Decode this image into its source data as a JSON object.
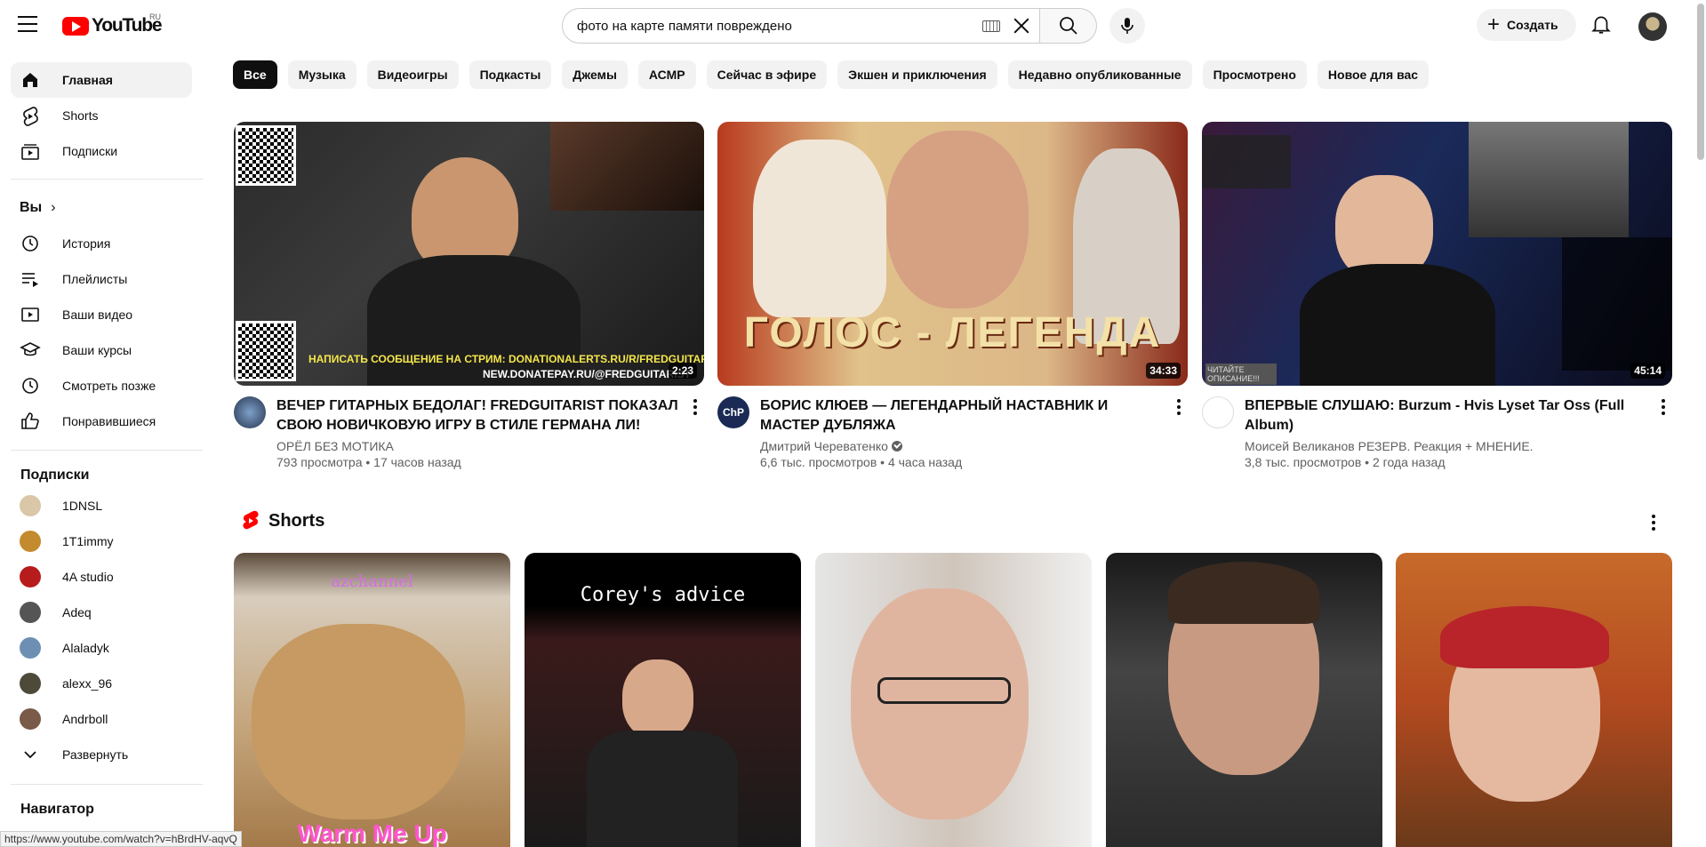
{
  "header": {
    "logo_text": "YouTube",
    "logo_region": "RU",
    "search_value": "фото на карте памяти повреждено",
    "create_label": "Создать"
  },
  "sidebar": {
    "main": [
      {
        "label": "Главная",
        "icon": "home-icon"
      },
      {
        "label": "Shorts",
        "icon": "shorts-icon"
      },
      {
        "label": "Подписки",
        "icon": "subscriptions-icon"
      }
    ],
    "you_heading": "Вы",
    "you": [
      {
        "label": "История",
        "icon": "history-icon"
      },
      {
        "label": "Плейлисты",
        "icon": "playlists-icon"
      },
      {
        "label": "Ваши видео",
        "icon": "your-videos-icon"
      },
      {
        "label": "Ваши курсы",
        "icon": "courses-icon"
      },
      {
        "label": "Смотреть позже",
        "icon": "watch-later-icon"
      },
      {
        "label": "Понравившиеся",
        "icon": "like-icon"
      }
    ],
    "subs_heading": "Подписки",
    "subs": [
      {
        "label": "1DNSL",
        "color": "#d9c7a8"
      },
      {
        "label": "1T1immy",
        "color": "#c48a2e"
      },
      {
        "label": "4A studio",
        "color": "#b71c1c"
      },
      {
        "label": "Adeq",
        "color": "#555555"
      },
      {
        "label": "Alaladyk",
        "color": "#6d8fb3"
      },
      {
        "label": "alexx_96",
        "color": "#4e4a3a"
      },
      {
        "label": "Andrboll",
        "color": "#7a5a48"
      }
    ],
    "expand_label": "Развернуть",
    "navigator_heading": "Навигатор"
  },
  "chips": [
    "Все",
    "Музыка",
    "Видеоигры",
    "Подкасты",
    "Джемы",
    "АСМР",
    "Сейчас в эфире",
    "Экшен и приключения",
    "Недавно опубликованные",
    "Просмотрено",
    "Новое для вас"
  ],
  "videos": [
    {
      "title": "ВЕЧЕР ГИТАРНЫХ БЕДОЛАГ! FREDGUITARIST ПОКАЗАЛ СВОЮ НОВИЧКОВУЮ ИГРУ В СТИЛЕ ГЕРМАНА ЛИ!",
      "channel": "ОРЁЛ БЕЗ МОТИКА",
      "meta": "793 просмотра • 17 часов назад",
      "duration": "2:23",
      "thumb_caption_1": "НАПИСАТЬ СООБЩЕНИЕ НА СТРИМ: DONATIONALERTS.RU/R/FREDGUITARIST",
      "thumb_caption_2": "NEW.DONATEPAY.RU/@FREDGUITARIST"
    },
    {
      "title": "БОРИС КЛЮЕВ — ЛЕГЕНДАРНЫЙ НАСТАВНИК И МАСТЕР ДУБЛЯЖА",
      "channel": "Дмитрий Череватенко",
      "meta": "6,6 тыс. просмотров • 4 часа назад",
      "duration": "34:33",
      "thumb_caption_1": "ГОЛОС - ЛЕГЕНДА",
      "avatar_text": "ChP"
    },
    {
      "title": "ВПЕРВЫЕ СЛУШАЮ: Burzum - Hvis Lyset Tar Oss (Full Album)",
      "channel": "Моисей Великанов РЕЗЕРВ. Реакция + МНЕНИЕ.",
      "meta": "3,8 тыс. просмотров • 2 года назад",
      "duration": "45:14",
      "thumb_caption_1": "ЧИТАЙТЕ ОПИСАНИЕ!!!"
    }
  ],
  "shorts": {
    "heading": "Shorts",
    "items": [
      {
        "caption_top": "azchannel",
        "caption_bottom": "Warm Me Up"
      },
      {
        "caption_top": "Corey's advice",
        "caption_bottom": ""
      },
      {
        "caption_top": "",
        "caption_bottom": ""
      },
      {
        "caption_top": "",
        "caption_bottom": ""
      },
      {
        "caption_top": "",
        "caption_bottom": ""
      }
    ]
  },
  "status_url": "https://www.youtube.com/watch?v=hBrdHV-aqvQ"
}
